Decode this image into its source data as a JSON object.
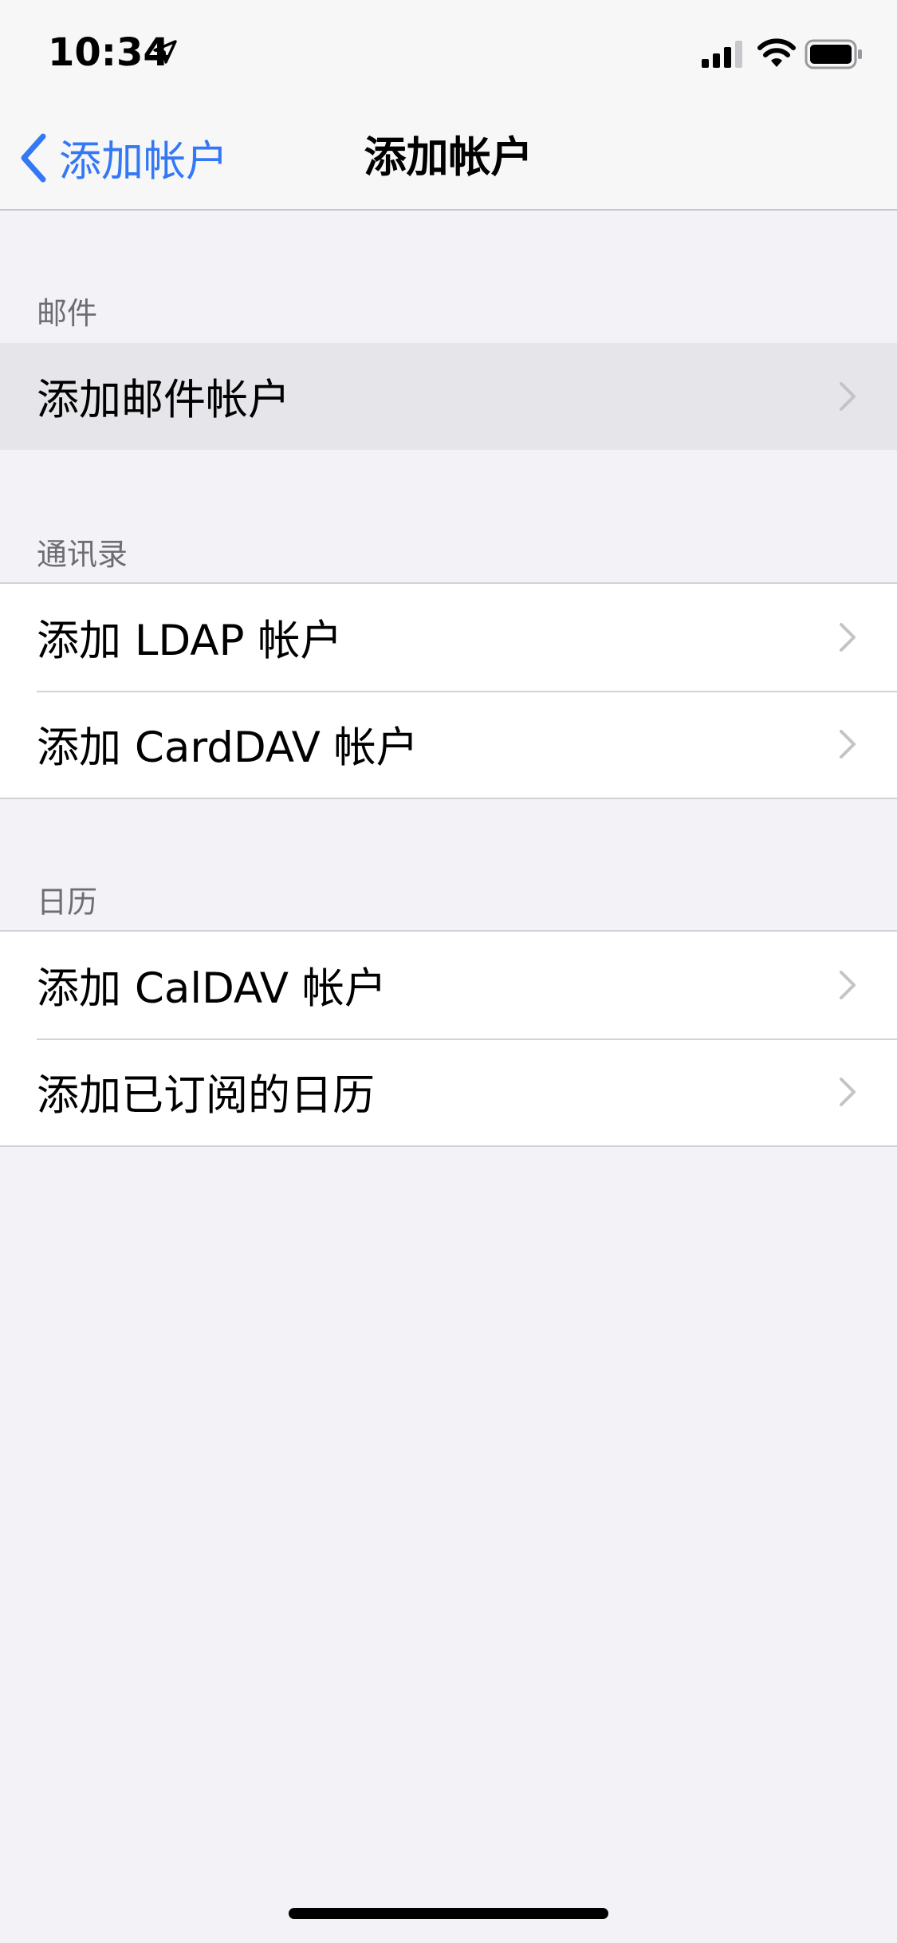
{
  "status_bar": {
    "time": "10:34",
    "icons": [
      "location-icon",
      "signal-icon",
      "wifi-icon",
      "battery-icon"
    ]
  },
  "nav": {
    "back_label": "添加帐户",
    "title": "添加帐户"
  },
  "sections": [
    {
      "header": "邮件",
      "rows": [
        {
          "label": "添加邮件帐户",
          "highlighted": true
        }
      ]
    },
    {
      "header": "通讯录",
      "rows": [
        {
          "label": "添加 LDAP 帐户"
        },
        {
          "label": "添加 CardDAV 帐户"
        }
      ]
    },
    {
      "header": "日历",
      "rows": [
        {
          "label": "添加 CalDAV 帐户"
        },
        {
          "label": "添加已订阅的日历"
        }
      ]
    }
  ],
  "colors": {
    "accent": "#3478f6",
    "background": "#f2f2f7",
    "cell_background": "#ffffff",
    "highlight": "#e5e5ea",
    "separator": "#d1d1d6",
    "section_header_text": "#6d6d72",
    "chevron": "#c4c4c7"
  }
}
